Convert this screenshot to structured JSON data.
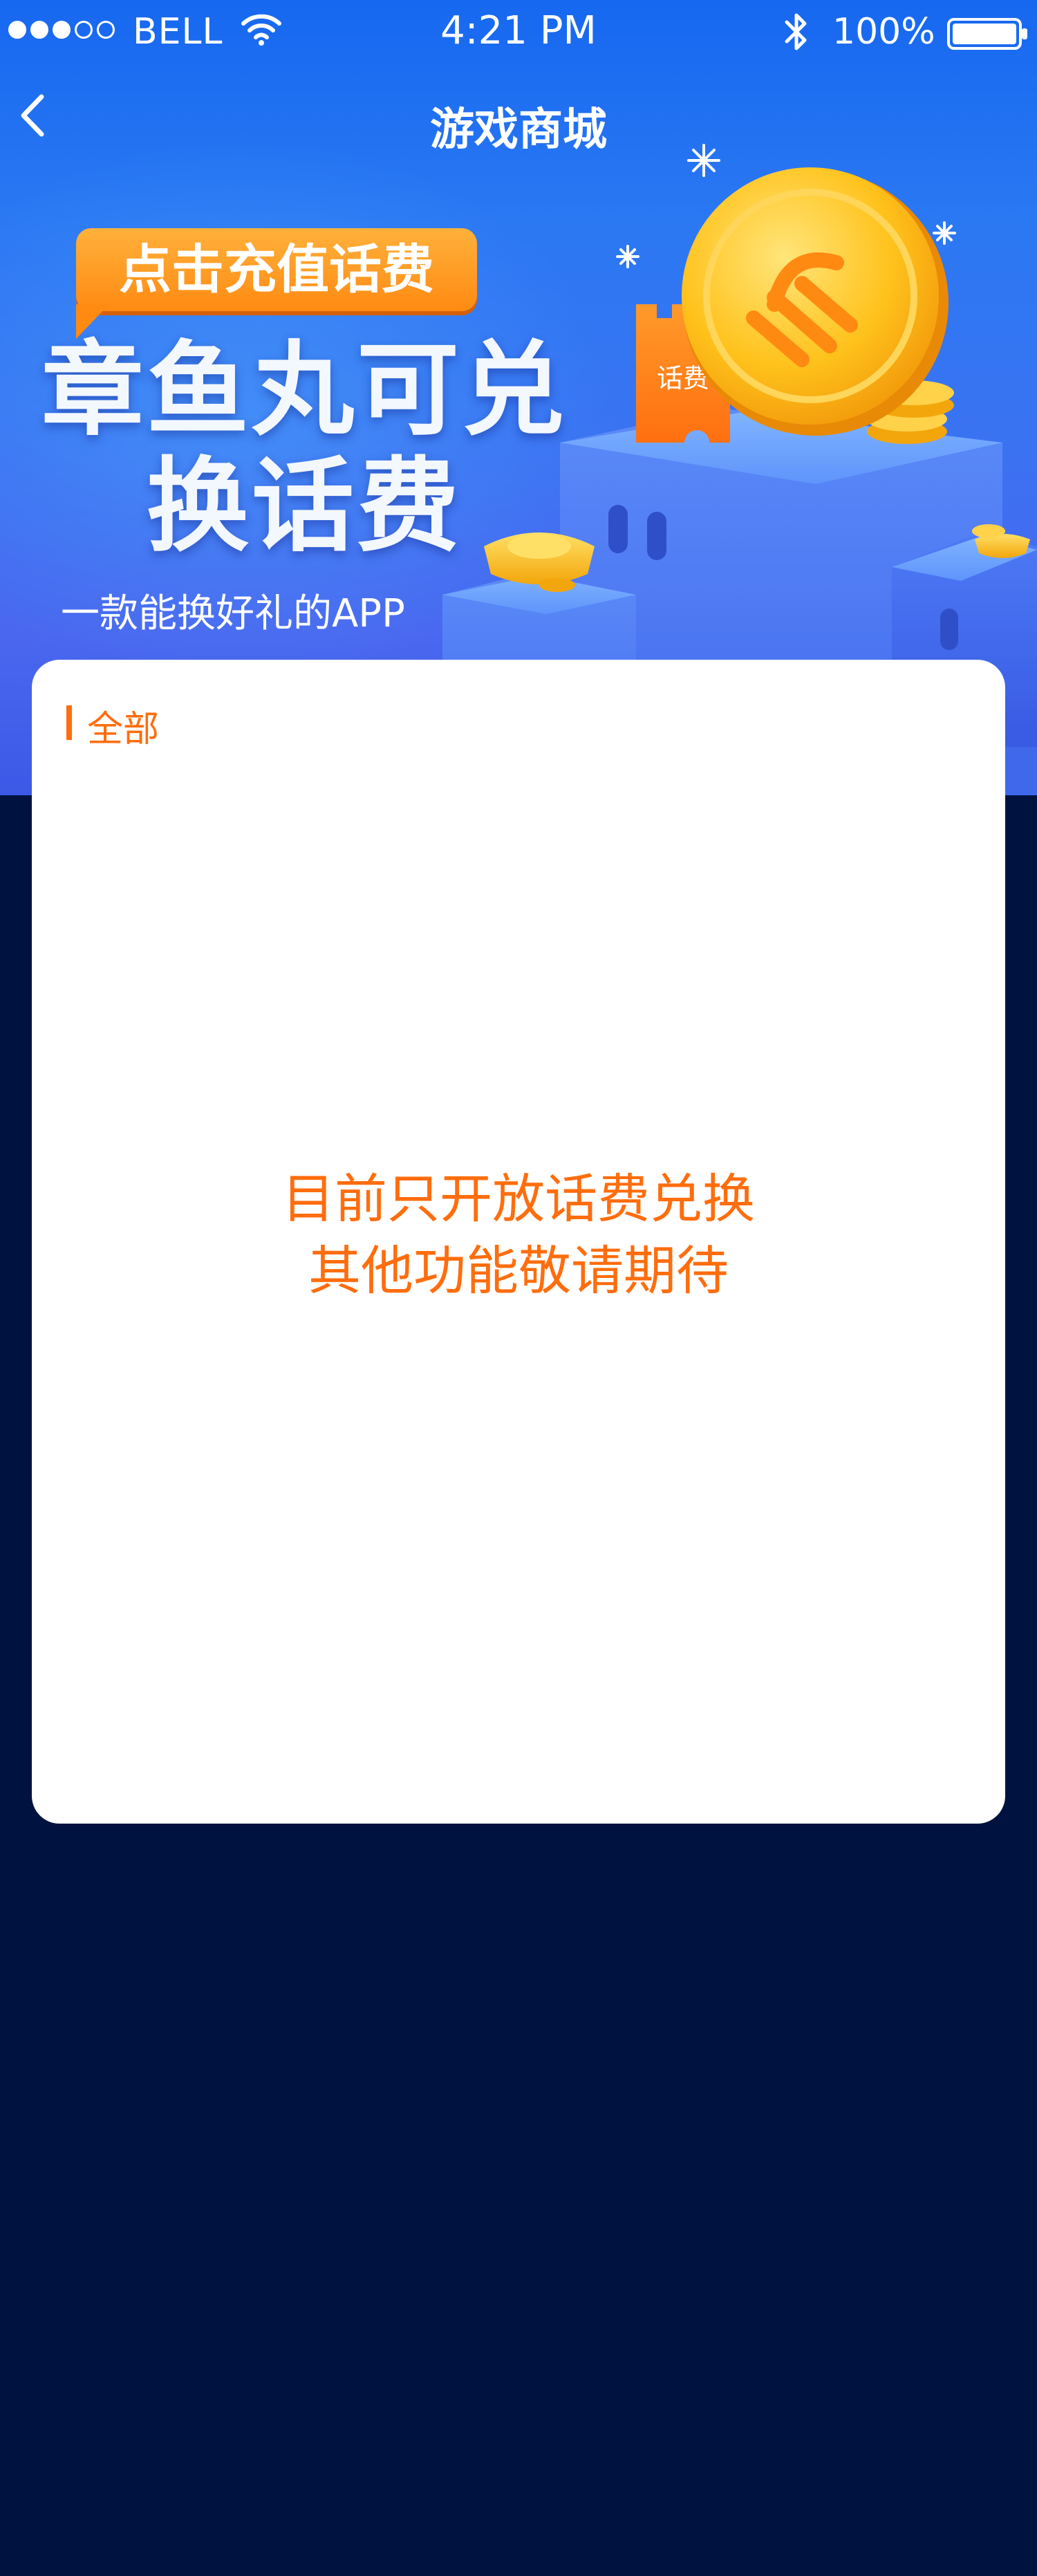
{
  "status_bar": {
    "carrier": "BELL",
    "time": "4:21 PM",
    "battery": "100%",
    "signal_strength": 3,
    "signal_max": 5
  },
  "nav": {
    "title": "游戏商城",
    "back_icon": "chevron-left-icon"
  },
  "banner": {
    "promo_tag": "点击充值话费",
    "headline_line1": "章鱼丸可兑",
    "headline_line2": "换话费",
    "tagline": "一款能换好礼的APP",
    "ticket_label": "话费",
    "colors": {
      "banner_blue": "#2b78f3",
      "promo_orange": "#ff8a12",
      "coin_gold": "#ffc21c"
    }
  },
  "content": {
    "category_label": "全部",
    "notice_line1": "目前只开放话费兑换",
    "notice_line2": "其他功能敬请期待",
    "accent_color": "#ff6d0d",
    "page_background": "#00123f"
  }
}
